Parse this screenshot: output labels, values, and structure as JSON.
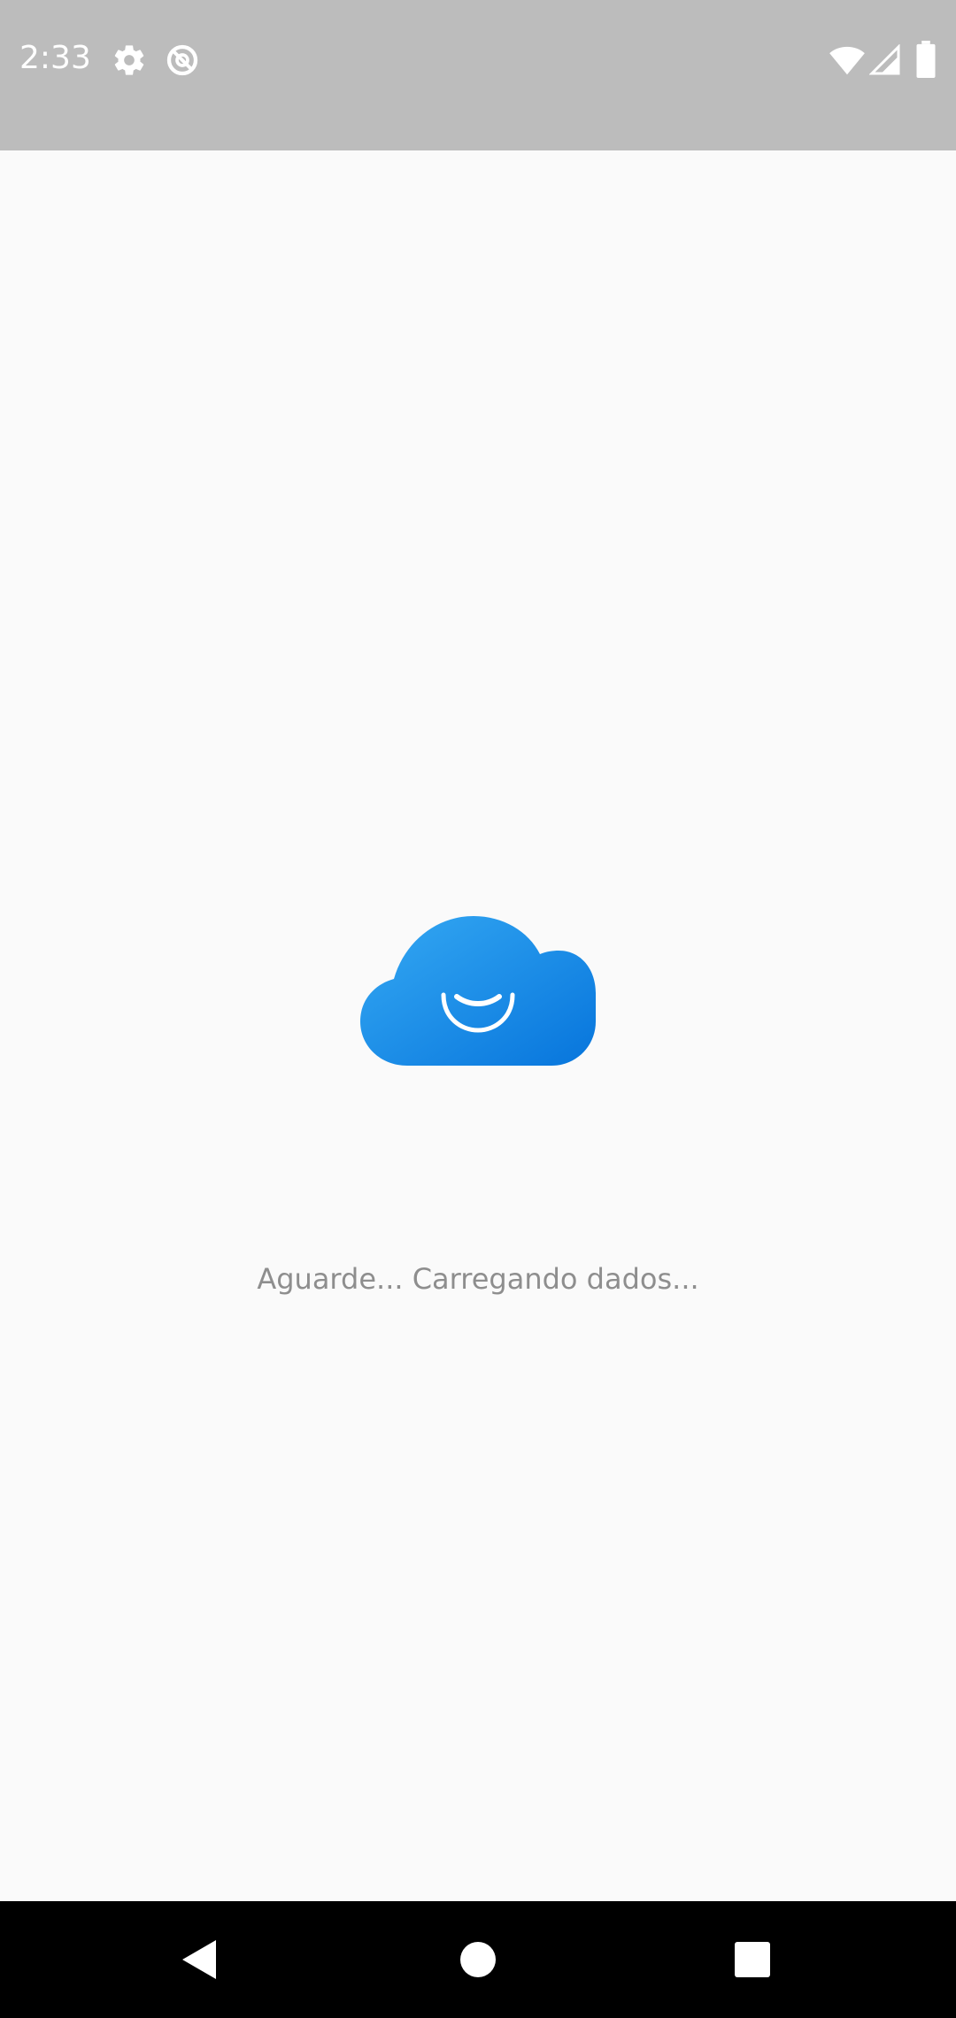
{
  "status_bar": {
    "time": "2:33",
    "left_icons": [
      "settings-gear-icon",
      "do-not-disturb-icon"
    ],
    "right_icons": [
      "wifi-icon",
      "cellular-signal-icon",
      "battery-icon"
    ],
    "background_color": "#bcbcbc"
  },
  "main": {
    "logo_icon": "cloud-loading-icon",
    "loading_text": "Aguarde... Carregando dados...",
    "accent_color": "#1a8fe3"
  },
  "nav_bar": {
    "buttons": [
      "back-icon",
      "home-icon",
      "recents-icon"
    ],
    "background_color": "#000000"
  }
}
